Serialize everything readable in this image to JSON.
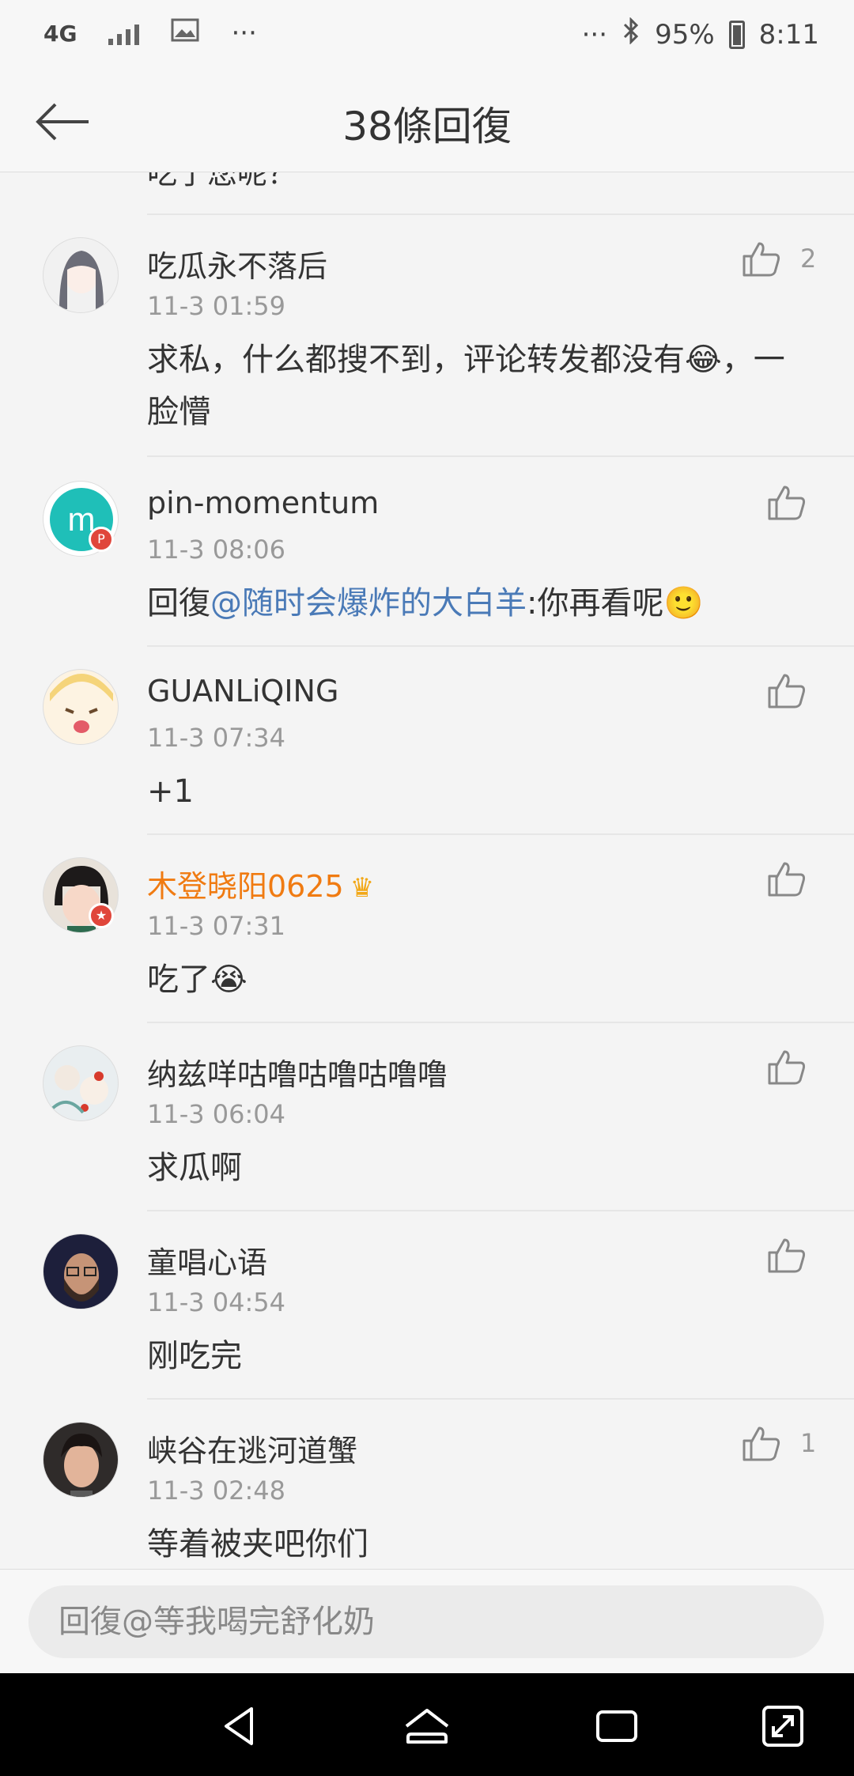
{
  "status_bar": {
    "network": "4G",
    "more_left": "···",
    "more_right": "···",
    "battery": "95%",
    "time": "8:11"
  },
  "nav": {
    "title": "38條回復"
  },
  "partial_comment": "吃了您呢？",
  "comments": [
    {
      "username": "吃瓜永不落后",
      "time": "11-3 01:59",
      "content": "求私，什么都搜不到，评论转发都没有😂，一脸懵",
      "likes": "2"
    },
    {
      "username": "pin-momentum",
      "time": "11-3 08:06",
      "reply_prefix": "回復",
      "mention": "@随时会爆炸的大白羊",
      "content_after": ":你再看呢🙂"
    },
    {
      "username": "GUANLiQING",
      "time": "11-3 07:34",
      "content": "+1"
    },
    {
      "username": "木登晓阳0625",
      "time": "11-3 07:31",
      "content": "吃了😭"
    },
    {
      "username": "纳兹咩咕噜咕噜咕噜噜",
      "time": "11-3 06:04",
      "content": "求瓜啊"
    },
    {
      "username": "童唱心语",
      "time": "11-3 04:54",
      "content": "刚吃完"
    },
    {
      "username": "峡谷在逃河道蟹",
      "time": "11-3 02:48",
      "content": "等着被夹吧你们",
      "likes": "1"
    }
  ],
  "reply": {
    "placeholder": "回復@等我喝完舒化奶"
  },
  "colors": {
    "mention": "#4a7ab7",
    "vip_name": "#f07b12",
    "badge": "#e0463b"
  }
}
